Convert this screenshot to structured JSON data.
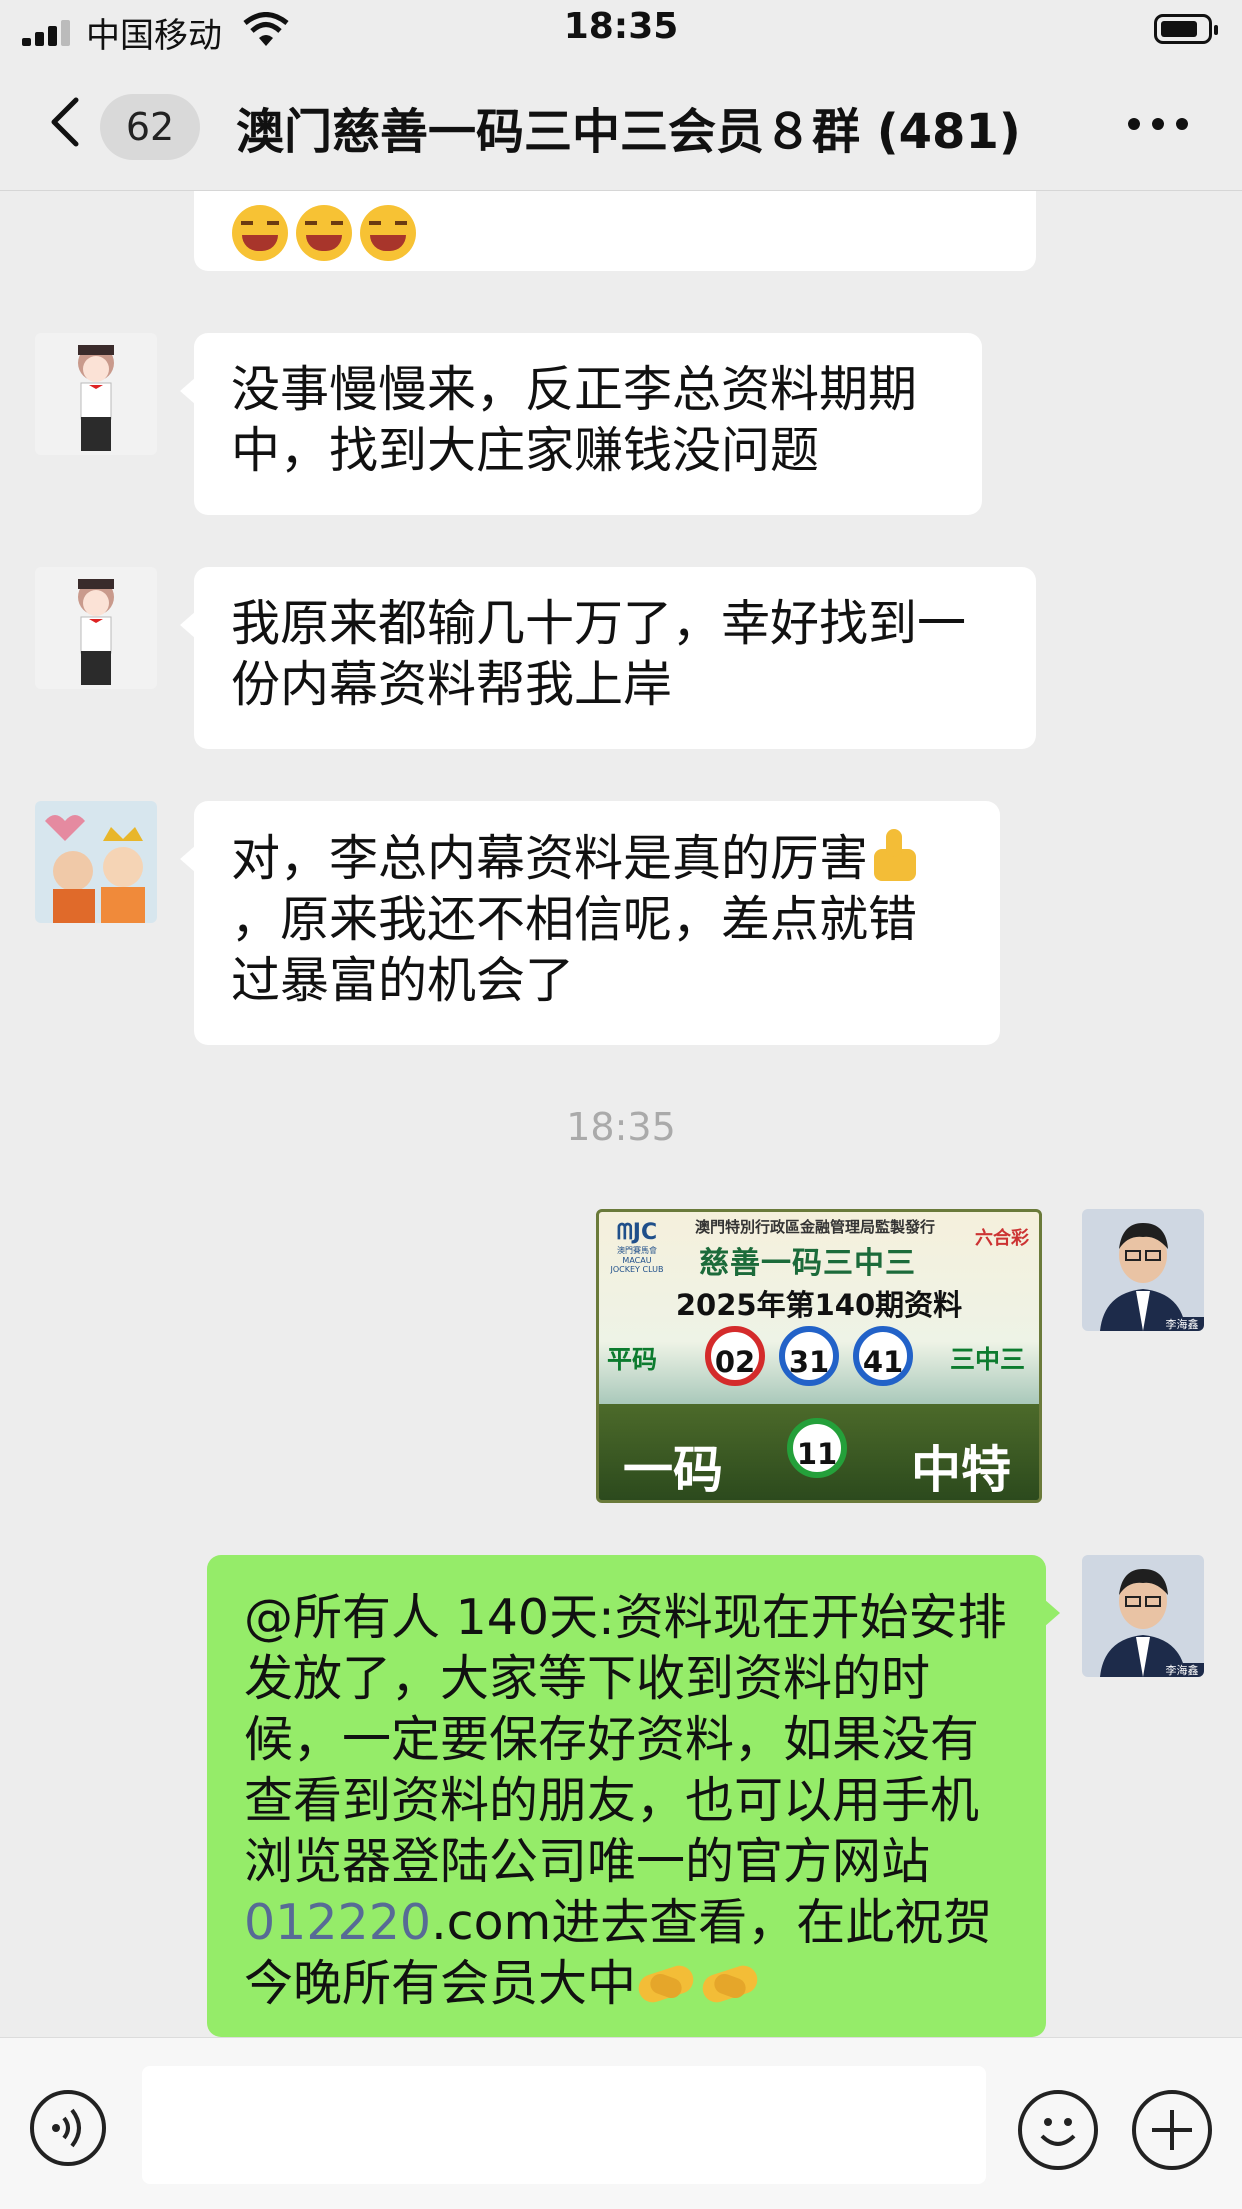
{
  "status_bar": {
    "carrier": "中国移动",
    "time": "18:35"
  },
  "nav": {
    "unread_count": "62",
    "title": "澳门慈善一码三中三会员８群 (481)"
  },
  "messages": [
    {
      "side": "in",
      "text": "没事慢慢来，反正李总资料期期中，找到大庄家赚钱没问题"
    },
    {
      "side": "in",
      "text": "我原来都输几十万了，幸好找到一份内幕资料帮我上岸"
    },
    {
      "side": "in",
      "text_before_emoji": "对，李总内幕资料是真的厉害",
      "text_after_emoji": "，原来我还不相信呢，差点就错过暴富的机会了"
    },
    {
      "timestamp": "18:35"
    },
    {
      "side": "out",
      "image": {
        "top_line": "澳門特別行政區金融管理局監製發行",
        "logo_text": "澳門賽馬會",
        "logo_sub": "MACAU JOCKEY CLUB",
        "brand": "六合彩",
        "title": "慈善一码三中三",
        "issue": "2025年第140期资料",
        "left_label": "平码",
        "right_label": "三中三",
        "balls": [
          "02",
          "31",
          "41"
        ],
        "bottom_left": "一码",
        "special_ball": "11",
        "bottom_right": "中特"
      }
    },
    {
      "side": "out",
      "text_part1": "@所有人 140天:资料现在开始安排发放了，大家等下收到资料的时候，一定要保存好资料，如果没有查看到资料的朋友，也可以用手机浏览器登陆公司唯一的官方网站",
      "link": "012220",
      "text_part2": ".com进去查看，在此祝贺今晚所有会员大中"
    }
  ],
  "avatar_caption": "李海鑫",
  "colors": {
    "background": "#ededed",
    "bubble_in": "#ffffff",
    "bubble_out": "#95ec69",
    "link": "#576b95"
  },
  "icons": [
    "back-arrow-icon",
    "more-icon",
    "voice-icon",
    "emoji-icon",
    "plus-icon"
  ]
}
